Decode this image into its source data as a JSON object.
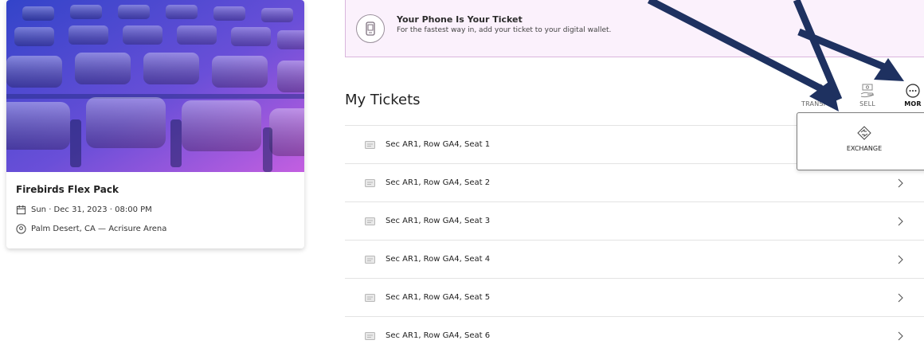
{
  "event": {
    "title": "Firebirds Flex Pack",
    "date": "Sun · Dec 31, 2023 · 08:00 PM",
    "venue": "Palm Desert, CA — Acrisure Arena"
  },
  "banner": {
    "title": "Your Phone Is Your Ticket",
    "subtitle": "For the fastest way in, add your ticket to your digital wallet."
  },
  "tickets_heading": "My Tickets",
  "actions": {
    "transfer": "TRANSFER",
    "sell": "SELL",
    "more": "MOR"
  },
  "exchange_label": "EXCHANGE",
  "tickets": [
    "Sec AR1, Row GA4, Seat 1",
    "Sec AR1, Row GA4, Seat 2",
    "Sec AR1, Row GA4, Seat 3",
    "Sec AR1, Row GA4, Seat 4",
    "Sec AR1, Row GA4, Seat 5",
    "Sec AR1, Row GA4, Seat 6"
  ],
  "colors": {
    "banner_bg": "#fbf1fc",
    "banner_border": "#d9b6dc",
    "image_gradient_start": "#3b4fd6",
    "image_gradient_end": "#c95ee0",
    "arrow": "#1e3160"
  },
  "icons": {
    "phone": "phone-icon",
    "calendar": "calendar-icon",
    "location": "location-pin-icon",
    "transfer": "transfer-icon",
    "sell": "sell-icon",
    "more": "more-icon",
    "exchange": "exchange-icon",
    "ticket": "ticket-icon",
    "chevron": "chevron-right-icon"
  }
}
